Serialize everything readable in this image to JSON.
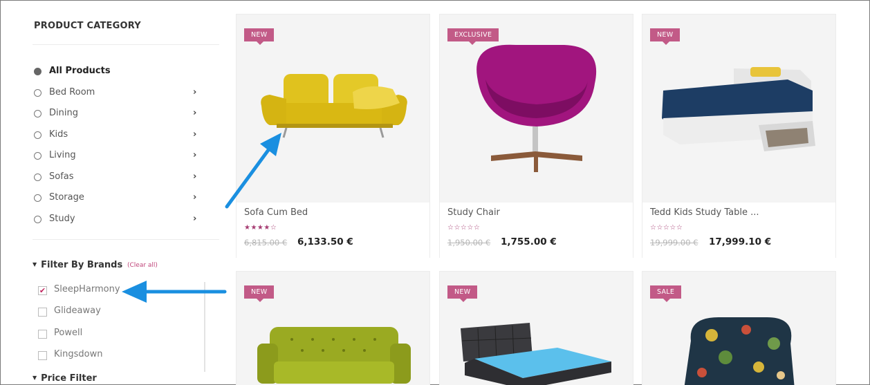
{
  "sidebar": {
    "category_title": "PRODUCT CATEGORY",
    "categories": [
      {
        "label": "All Products",
        "selected": true
      },
      {
        "label": "Bed Room",
        "selected": false
      },
      {
        "label": "Dining",
        "selected": false
      },
      {
        "label": "Kids",
        "selected": false
      },
      {
        "label": "Living",
        "selected": false
      },
      {
        "label": "Sofas",
        "selected": false
      },
      {
        "label": "Storage",
        "selected": false
      },
      {
        "label": "Study",
        "selected": false
      }
    ],
    "chevron": "›",
    "brands_title": "Filter By Brands",
    "clear_all": "(Clear all)",
    "brands": [
      {
        "label": "SleepHarmony",
        "checked": true
      },
      {
        "label": "Glideaway",
        "checked": false
      },
      {
        "label": "Powell",
        "checked": false
      },
      {
        "label": "Kingsdown",
        "checked": false
      }
    ],
    "price_title": "Price Filter"
  },
  "products": [
    {
      "badge": "NEW",
      "name": "Sofa Cum Bed",
      "rating": 4,
      "old_price": "6,815.00 €",
      "price": "6,133.50 €"
    },
    {
      "badge": "EXCLUSIVE",
      "name": "Study Chair",
      "rating": 0,
      "old_price": "1,950.00 €",
      "price": "1,755.00 €"
    },
    {
      "badge": "NEW",
      "name": "Tedd Kids Study Table ...",
      "rating": 0,
      "old_price": "19,999.00 €",
      "price": "17,999.10 €"
    },
    {
      "badge": "NEW",
      "name": "",
      "rating": null,
      "old_price": "",
      "price": ""
    },
    {
      "badge": "NEW",
      "name": "",
      "rating": null,
      "old_price": "",
      "price": ""
    },
    {
      "badge": "SALE",
      "name": "",
      "rating": null,
      "old_price": "",
      "price": ""
    }
  ],
  "colors": {
    "badge": "#c25a87",
    "star": "#a63c72",
    "annotation_arrow": "#1a8fe0",
    "clear_link": "#c0457a"
  }
}
